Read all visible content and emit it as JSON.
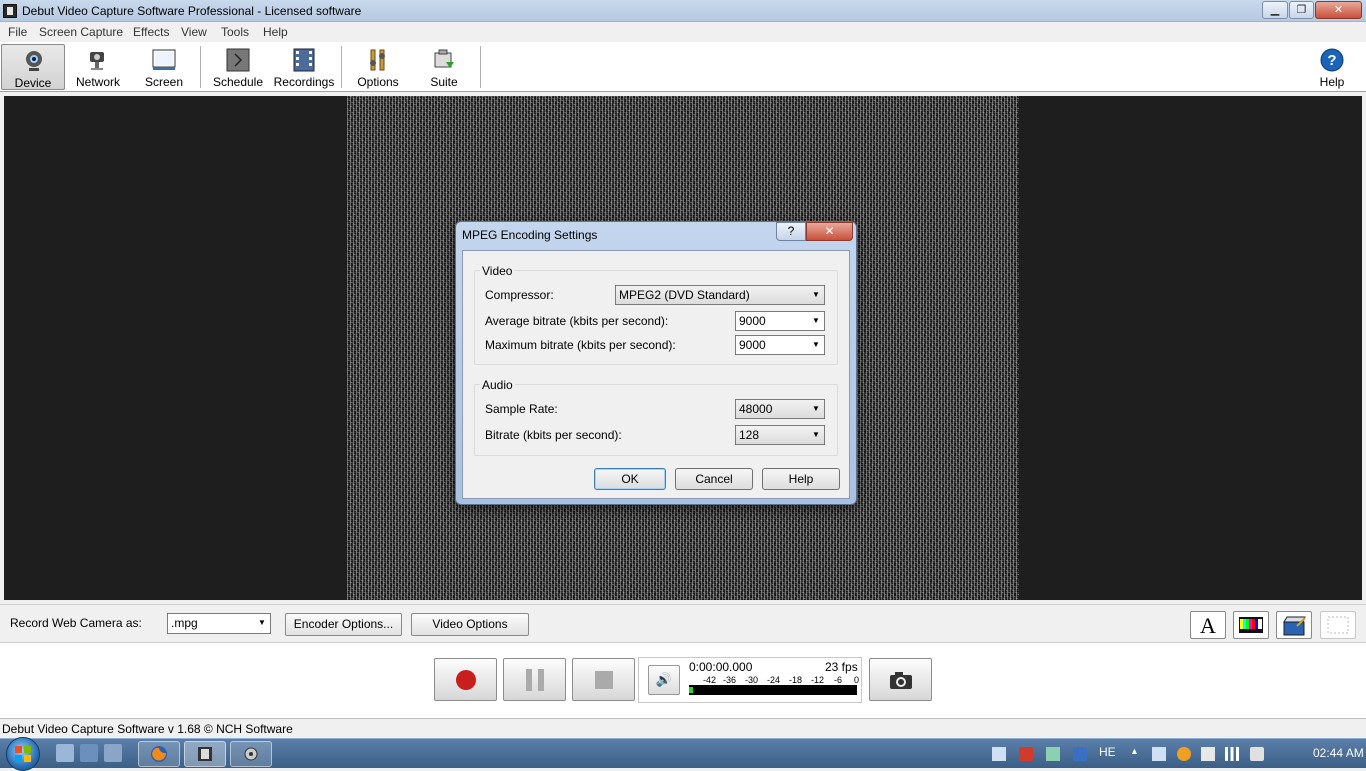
{
  "window": {
    "title": "Debut Video Capture Software Professional - Licensed software",
    "min_glyph": "▁",
    "max_glyph": "❐",
    "close_glyph": "✕"
  },
  "menu": [
    "File",
    "Screen Capture",
    "Effects",
    "View",
    "Tools",
    "Help"
  ],
  "toolbar": {
    "device": "Device",
    "network": "Network",
    "screen": "Screen",
    "schedule": "Schedule",
    "recordings": "Recordings",
    "options": "Options",
    "suite": "Suite",
    "help": "Help"
  },
  "dialog": {
    "title": "MPEG Encoding Settings",
    "help_glyph": "?",
    "close_glyph": "✕",
    "video_group": "Video",
    "compressor_label": "Compressor:",
    "compressor_value": "MPEG2 (DVD Standard)",
    "avg_bitrate_label": "Average bitrate (kbits per second):",
    "avg_bitrate_value": "9000",
    "max_bitrate_label": "Maximum bitrate (kbits per second):",
    "max_bitrate_value": "9000",
    "audio_group": "Audio",
    "sample_rate_label": "Sample Rate:",
    "sample_rate_value": "48000",
    "audio_bitrate_label": "Bitrate (kbits per second):",
    "audio_bitrate_value": "128",
    "ok": "OK",
    "cancel": "Cancel",
    "help": "Help"
  },
  "recordbar": {
    "label": "Record Web Camera as:",
    "format": ".mpg",
    "encoder_options": "Encoder Options...",
    "video_options": "Video Options",
    "text_tool_glyph": "A"
  },
  "transport": {
    "timecode": "0:00:00.000",
    "fps": "23 fps",
    "scale": [
      "-42",
      "-36",
      "-30",
      "-24",
      "-18",
      "-12",
      "-6",
      "0"
    ],
    "volume_glyph": "🔊"
  },
  "status": "Debut Video Capture Software v 1.68 © NCH Software",
  "taskbar": {
    "language": "HE",
    "clock": "02:44 AM",
    "tray_arrow": "▲"
  },
  "colors": {
    "record_red": "#c81e1e",
    "dialog_frame": "#b7cce6",
    "close_red": "#c9503c"
  }
}
